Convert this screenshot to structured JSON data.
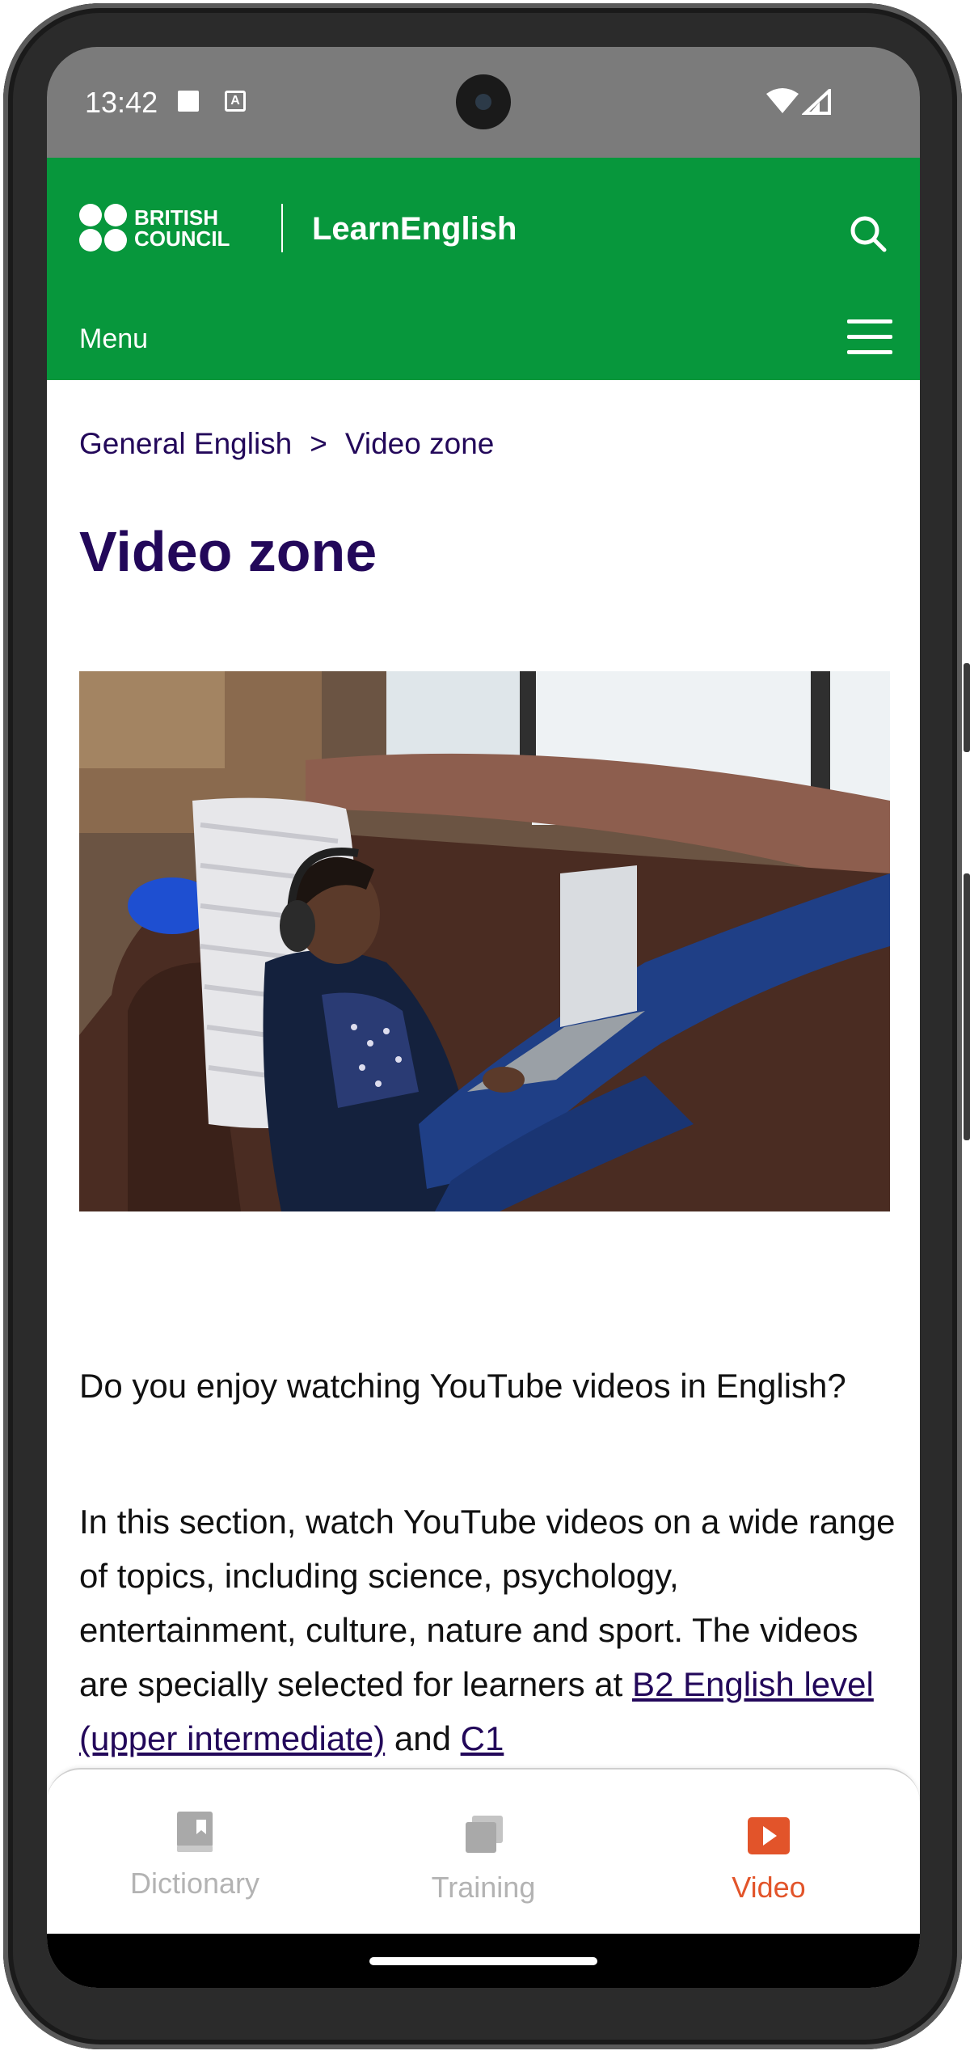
{
  "status_bar": {
    "time": "13:42",
    "notif_badge": "A"
  },
  "header": {
    "brand_line1": "BRITISH",
    "brand_line2": "COUNCIL",
    "site_title": "LearnEnglish",
    "menu_label": "Menu",
    "color": "#07973c"
  },
  "breadcrumb": {
    "items": [
      "General English",
      "Video zone"
    ],
    "separator": ">"
  },
  "page": {
    "title": "Video zone",
    "intro": "Do you enjoy watching YouTube videos in English?",
    "body_part1": "In this section, watch YouTube videos on a wide range of topics, including science, psychology, entertainment, culture, nature and sport. The videos are specially selected for learners at ",
    "link_b2": "B2 English level (upper intermediate)",
    "body_part2": " and ",
    "link_c1": "C1"
  },
  "bottom_nav": {
    "items": [
      {
        "label": "Dictionary",
        "icon": "book-icon",
        "active": false
      },
      {
        "label": "Training",
        "icon": "cards-icon",
        "active": false
      },
      {
        "label": "Video",
        "icon": "play-icon",
        "active": true
      }
    ],
    "active_color": "#e2542a",
    "inactive_color": "#b3b3b3"
  }
}
